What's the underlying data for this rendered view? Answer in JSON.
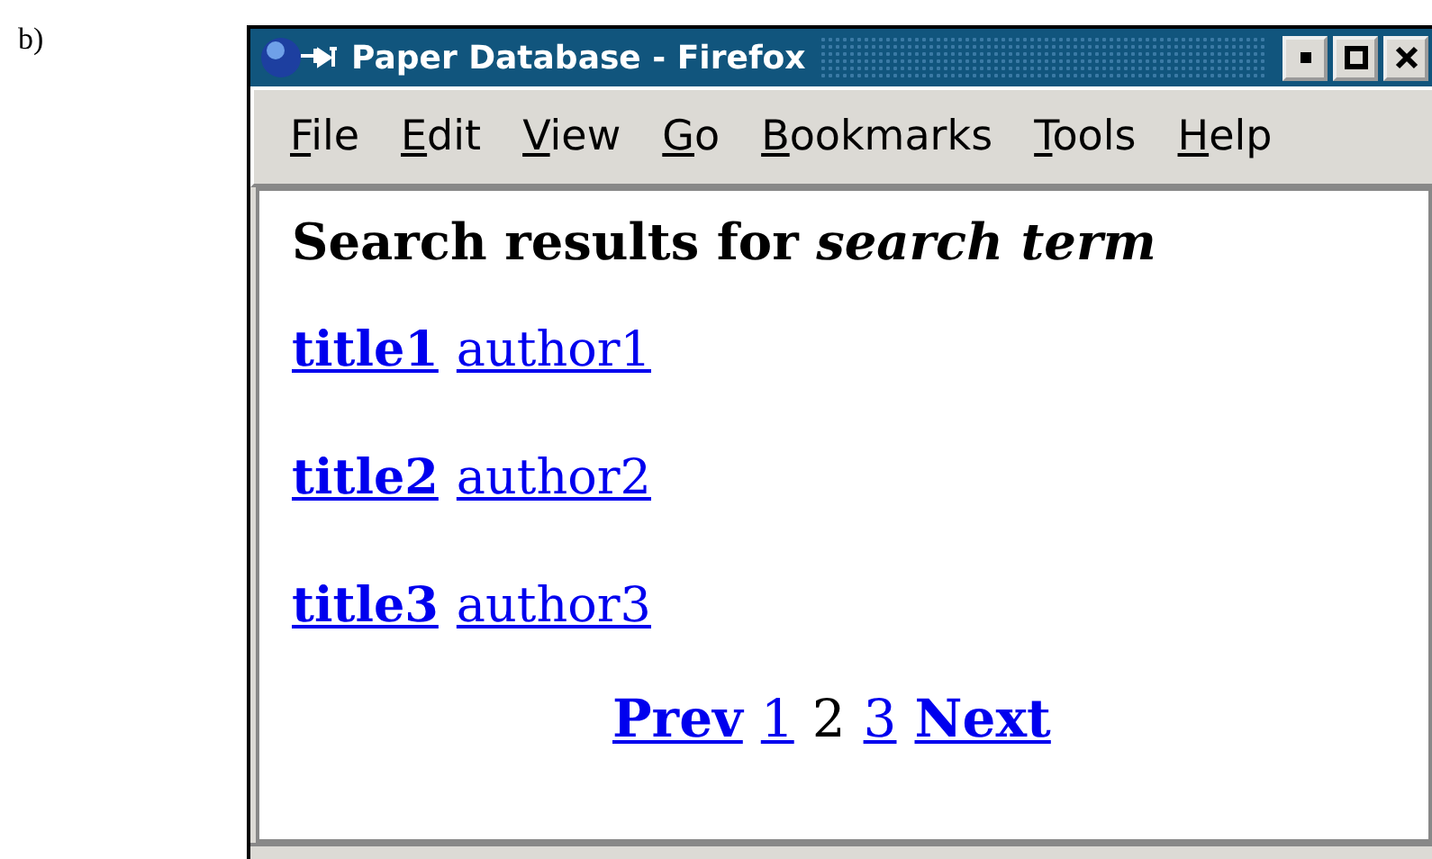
{
  "figure_label": "b)",
  "window": {
    "title": "Paper Database - Firefox"
  },
  "menu": [
    "File",
    "Edit",
    "View",
    "Go",
    "Bookmarks",
    "Tools",
    "Help"
  ],
  "heading": "Search results for *search term*",
  "results": [
    {
      "title": "title1",
      "author": "author1"
    },
    {
      "title": "title2",
      "author": "author2"
    },
    {
      "title": "title3",
      "author": "author3"
    }
  ],
  "pagination": [
    {
      "label": "Prev",
      "kind": "nav",
      "selected": false
    },
    {
      "label": "1",
      "kind": "page",
      "selected": false
    },
    {
      "label": "2",
      "kind": "page",
      "selected": true
    },
    {
      "label": "3",
      "kind": "page",
      "selected": false
    },
    {
      "label": "Next",
      "kind": "nav",
      "selected": false
    }
  ]
}
